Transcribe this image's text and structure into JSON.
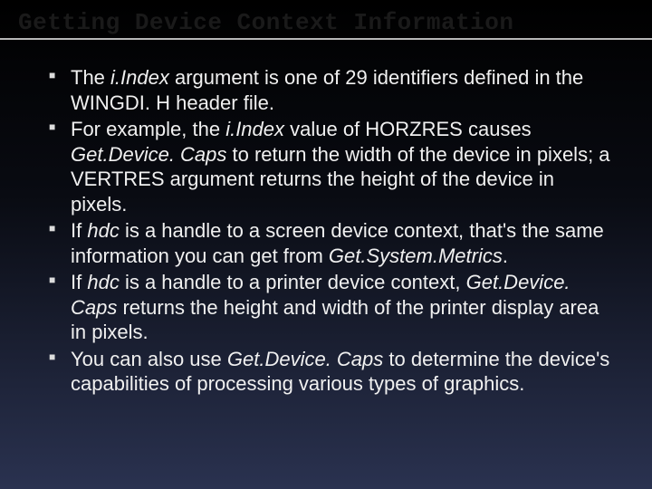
{
  "title": "Getting Device Context Information",
  "bullets": [
    {
      "segments": [
        {
          "t": "The "
        },
        {
          "t": "i.Index",
          "italic": true
        },
        {
          "t": " argument is one of 29 identifiers defined in the WINGDI. H header file."
        }
      ]
    },
    {
      "segments": [
        {
          "t": "For example, the "
        },
        {
          "t": "i.Index",
          "italic": true
        },
        {
          "t": " value of HORZRES causes "
        },
        {
          "t": "Get.Device. Caps",
          "italic": true
        },
        {
          "t": " to return the width of the device in pixels; a VERTRES argument returns the height of the device in pixels."
        }
      ]
    },
    {
      "segments": [
        {
          "t": "If "
        },
        {
          "t": "hdc",
          "italic": true
        },
        {
          "t": " is a handle to a screen device context, that's the same information you can get from "
        },
        {
          "t": "Get.System.Metrics",
          "italic": true
        },
        {
          "t": "."
        }
      ]
    },
    {
      "segments": [
        {
          "t": "If "
        },
        {
          "t": "hdc",
          "italic": true
        },
        {
          "t": " is a handle to a printer device context, "
        },
        {
          "t": "Get.Device. Caps",
          "italic": true
        },
        {
          "t": " returns the height and width of the printer display area in pixels."
        }
      ]
    },
    {
      "segments": [
        {
          "t": "You can also use "
        },
        {
          "t": "Get.Device. Caps",
          "italic": true
        },
        {
          "t": " to determine the device's capabilities of processing various types of graphics."
        }
      ]
    }
  ]
}
